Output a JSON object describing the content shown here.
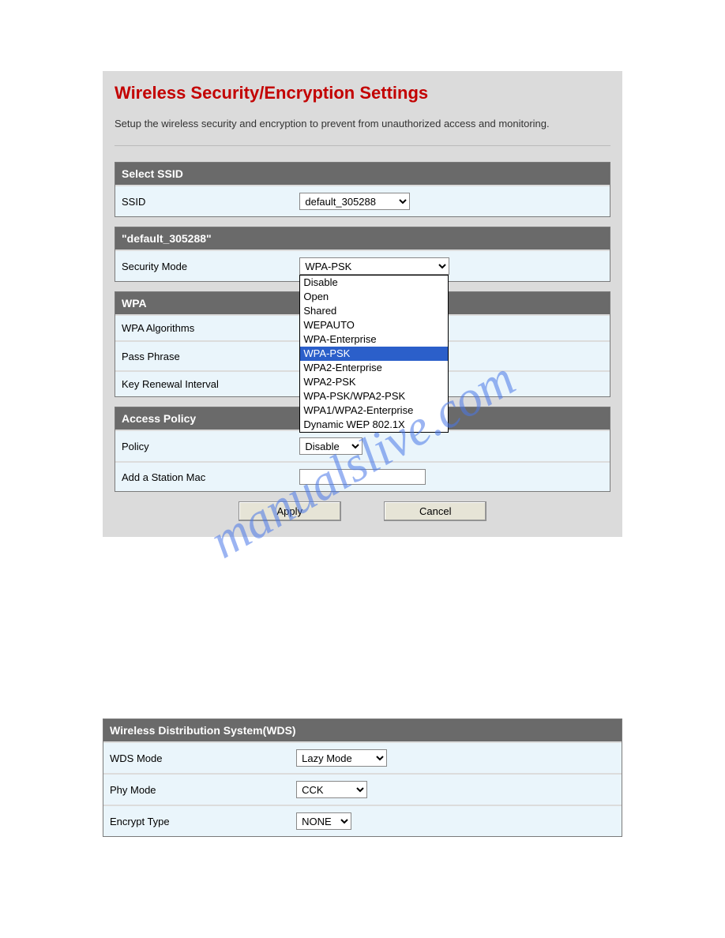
{
  "page": {
    "title": "Wireless Security/Encryption Settings",
    "subtitle": "Setup the wireless security and encryption to prevent from unauthorized access and monitoring."
  },
  "select_ssid": {
    "header": "Select SSID",
    "ssid_label": "SSID",
    "ssid_value": "default_305288"
  },
  "ssid_section": {
    "header": "\"default_305288\"",
    "security_mode_label": "Security Mode",
    "security_mode_value": "WPA-PSK",
    "security_mode_options": [
      "Disable",
      "Open",
      "Shared",
      "WEPAUTO",
      "WPA-Enterprise",
      "WPA-PSK",
      "WPA2-Enterprise",
      "WPA2-PSK",
      "WPA-PSK/WPA2-PSK",
      "WPA1/WPA2-Enterprise",
      "Dynamic WEP 802.1X"
    ]
  },
  "wpa": {
    "header": "WPA",
    "algorithms_label": "WPA Algorithms",
    "pass_phrase_label": "Pass Phrase",
    "pass_phrase_value": "",
    "key_renewal_label": "Key Renewal Interval"
  },
  "access_policy": {
    "header": "Access Policy",
    "policy_label": "Policy",
    "policy_value": "Disable",
    "add_station_label": "Add a Station Mac",
    "add_station_value": ""
  },
  "buttons": {
    "apply": "Apply",
    "cancel": "Cancel"
  },
  "wds": {
    "header": "Wireless Distribution System(WDS)",
    "mode_label": "WDS Mode",
    "mode_value": "Lazy Mode",
    "phy_label": "Phy Mode",
    "phy_value": "CCK",
    "encrypt_label": "Encrypt Type",
    "encrypt_value": "NONE"
  },
  "watermark": "manualslive.com"
}
